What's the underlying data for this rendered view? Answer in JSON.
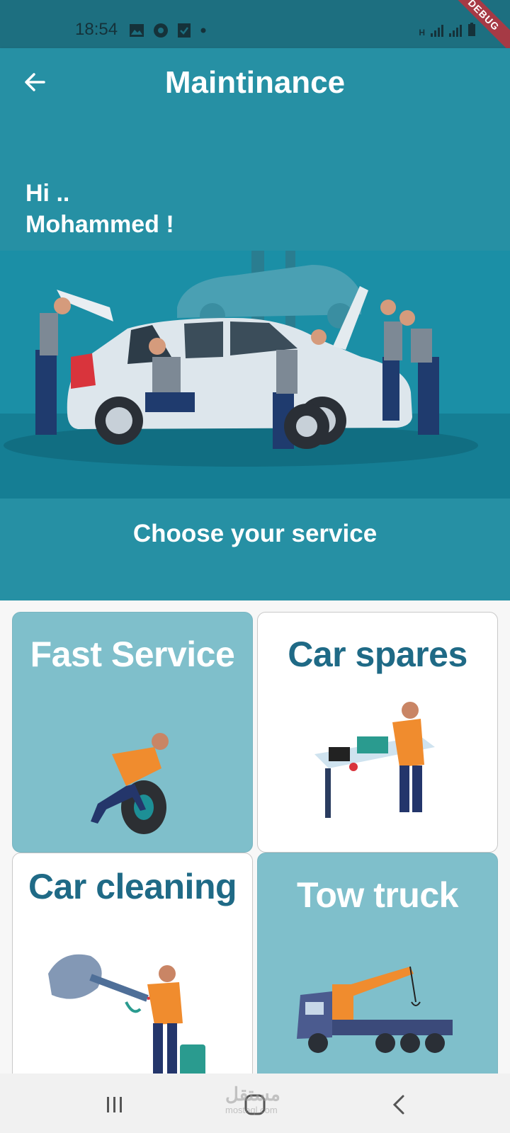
{
  "status_bar": {
    "time": "18:54",
    "debug_label": "DEBUG"
  },
  "app_bar": {
    "title": "Maintinance"
  },
  "greeting": {
    "line1": "Hi ..",
    "line2": "Mohammed !"
  },
  "section": {
    "heading": "Choose  your service"
  },
  "services": [
    {
      "label": "Fast Service",
      "bg": "#7fbfcb",
      "text_color": "#ffffff"
    },
    {
      "label": "Car spares",
      "bg": "#ffffff",
      "text_color": "#1f6a86"
    },
    {
      "label": "Car cleaning",
      "bg": "#ffffff",
      "text_color": "#1f6a86"
    },
    {
      "label": "Tow truck",
      "bg": "#7fbfcb",
      "text_color": "#ffffff"
    }
  ],
  "watermark": {
    "text": "مستقل",
    "sub": "mostaql.com"
  },
  "colors": {
    "primary": "#2690a4",
    "status_bar": "#1d6f80"
  }
}
